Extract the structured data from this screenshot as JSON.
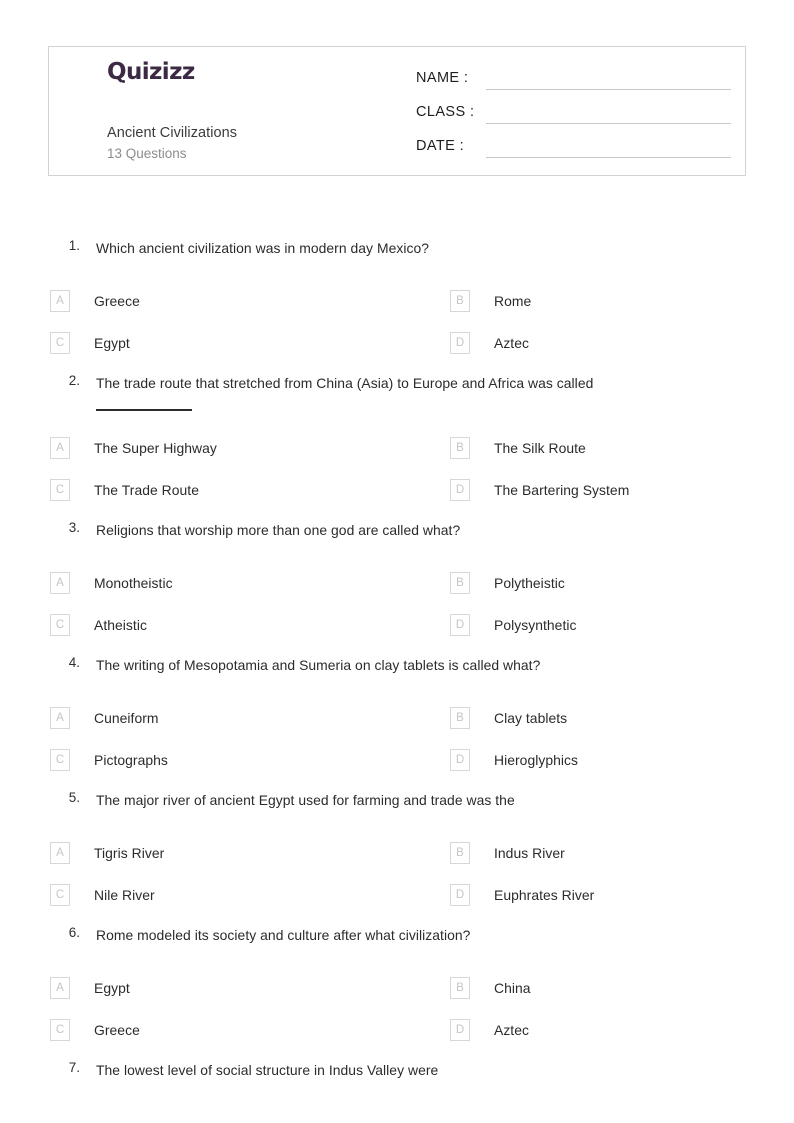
{
  "header": {
    "logo_text": "Quizizz",
    "logo_color": "#3c2a45",
    "quiz_title": "Ancient Civilizations",
    "question_count_label": "13 Questions",
    "meta_fields": [
      {
        "label": "NAME :"
      },
      {
        "label": "CLASS :"
      },
      {
        "label": "DATE  :"
      }
    ]
  },
  "questions": [
    {
      "number": "1.",
      "text": "Which ancient civilization was in modern day Mexico?",
      "has_blank": false,
      "options": [
        {
          "letter": "A",
          "text": "Greece"
        },
        {
          "letter": "B",
          "text": "Rome"
        },
        {
          "letter": "C",
          "text": "Egypt"
        },
        {
          "letter": "D",
          "text": "Aztec"
        }
      ]
    },
    {
      "number": "2.",
      "text": "The trade route that stretched from China (Asia) to Europe and Africa was called",
      "has_blank": true,
      "options": [
        {
          "letter": "A",
          "text": "The Super Highway"
        },
        {
          "letter": "B",
          "text": "The Silk Route"
        },
        {
          "letter": "C",
          "text": "The Trade Route"
        },
        {
          "letter": "D",
          "text": "The Bartering System"
        }
      ]
    },
    {
      "number": "3.",
      "text": "Religions that worship more than one god are called what?",
      "has_blank": false,
      "options": [
        {
          "letter": "A",
          "text": "Monotheistic"
        },
        {
          "letter": "B",
          "text": "Polytheistic"
        },
        {
          "letter": "C",
          "text": "Atheistic"
        },
        {
          "letter": "D",
          "text": "Polysynthetic"
        }
      ]
    },
    {
      "number": "4.",
      "text": "The writing of Mesopotamia and Sumeria on clay tablets is called what?",
      "has_blank": false,
      "options": [
        {
          "letter": "A",
          "text": "Cuneiform"
        },
        {
          "letter": "B",
          "text": "Clay tablets"
        },
        {
          "letter": "C",
          "text": "Pictographs"
        },
        {
          "letter": "D",
          "text": "Hieroglyphics"
        }
      ]
    },
    {
      "number": "5.",
      "text": "The major river of ancient Egypt used for farming and trade was the",
      "has_blank": false,
      "options": [
        {
          "letter": "A",
          "text": "Tigris River"
        },
        {
          "letter": "B",
          "text": "Indus River"
        },
        {
          "letter": "C",
          "text": "Nile River"
        },
        {
          "letter": "D",
          "text": "Euphrates River"
        }
      ]
    },
    {
      "number": "6.",
      "text": "Rome modeled its society and culture after what civilization?",
      "has_blank": false,
      "options": [
        {
          "letter": "A",
          "text": "Egypt"
        },
        {
          "letter": "B",
          "text": "China"
        },
        {
          "letter": "C",
          "text": "Greece"
        },
        {
          "letter": "D",
          "text": "Aztec"
        }
      ]
    },
    {
      "number": "7.",
      "text": "The lowest level of social structure in Indus Valley were",
      "has_blank": false,
      "options": []
    }
  ]
}
